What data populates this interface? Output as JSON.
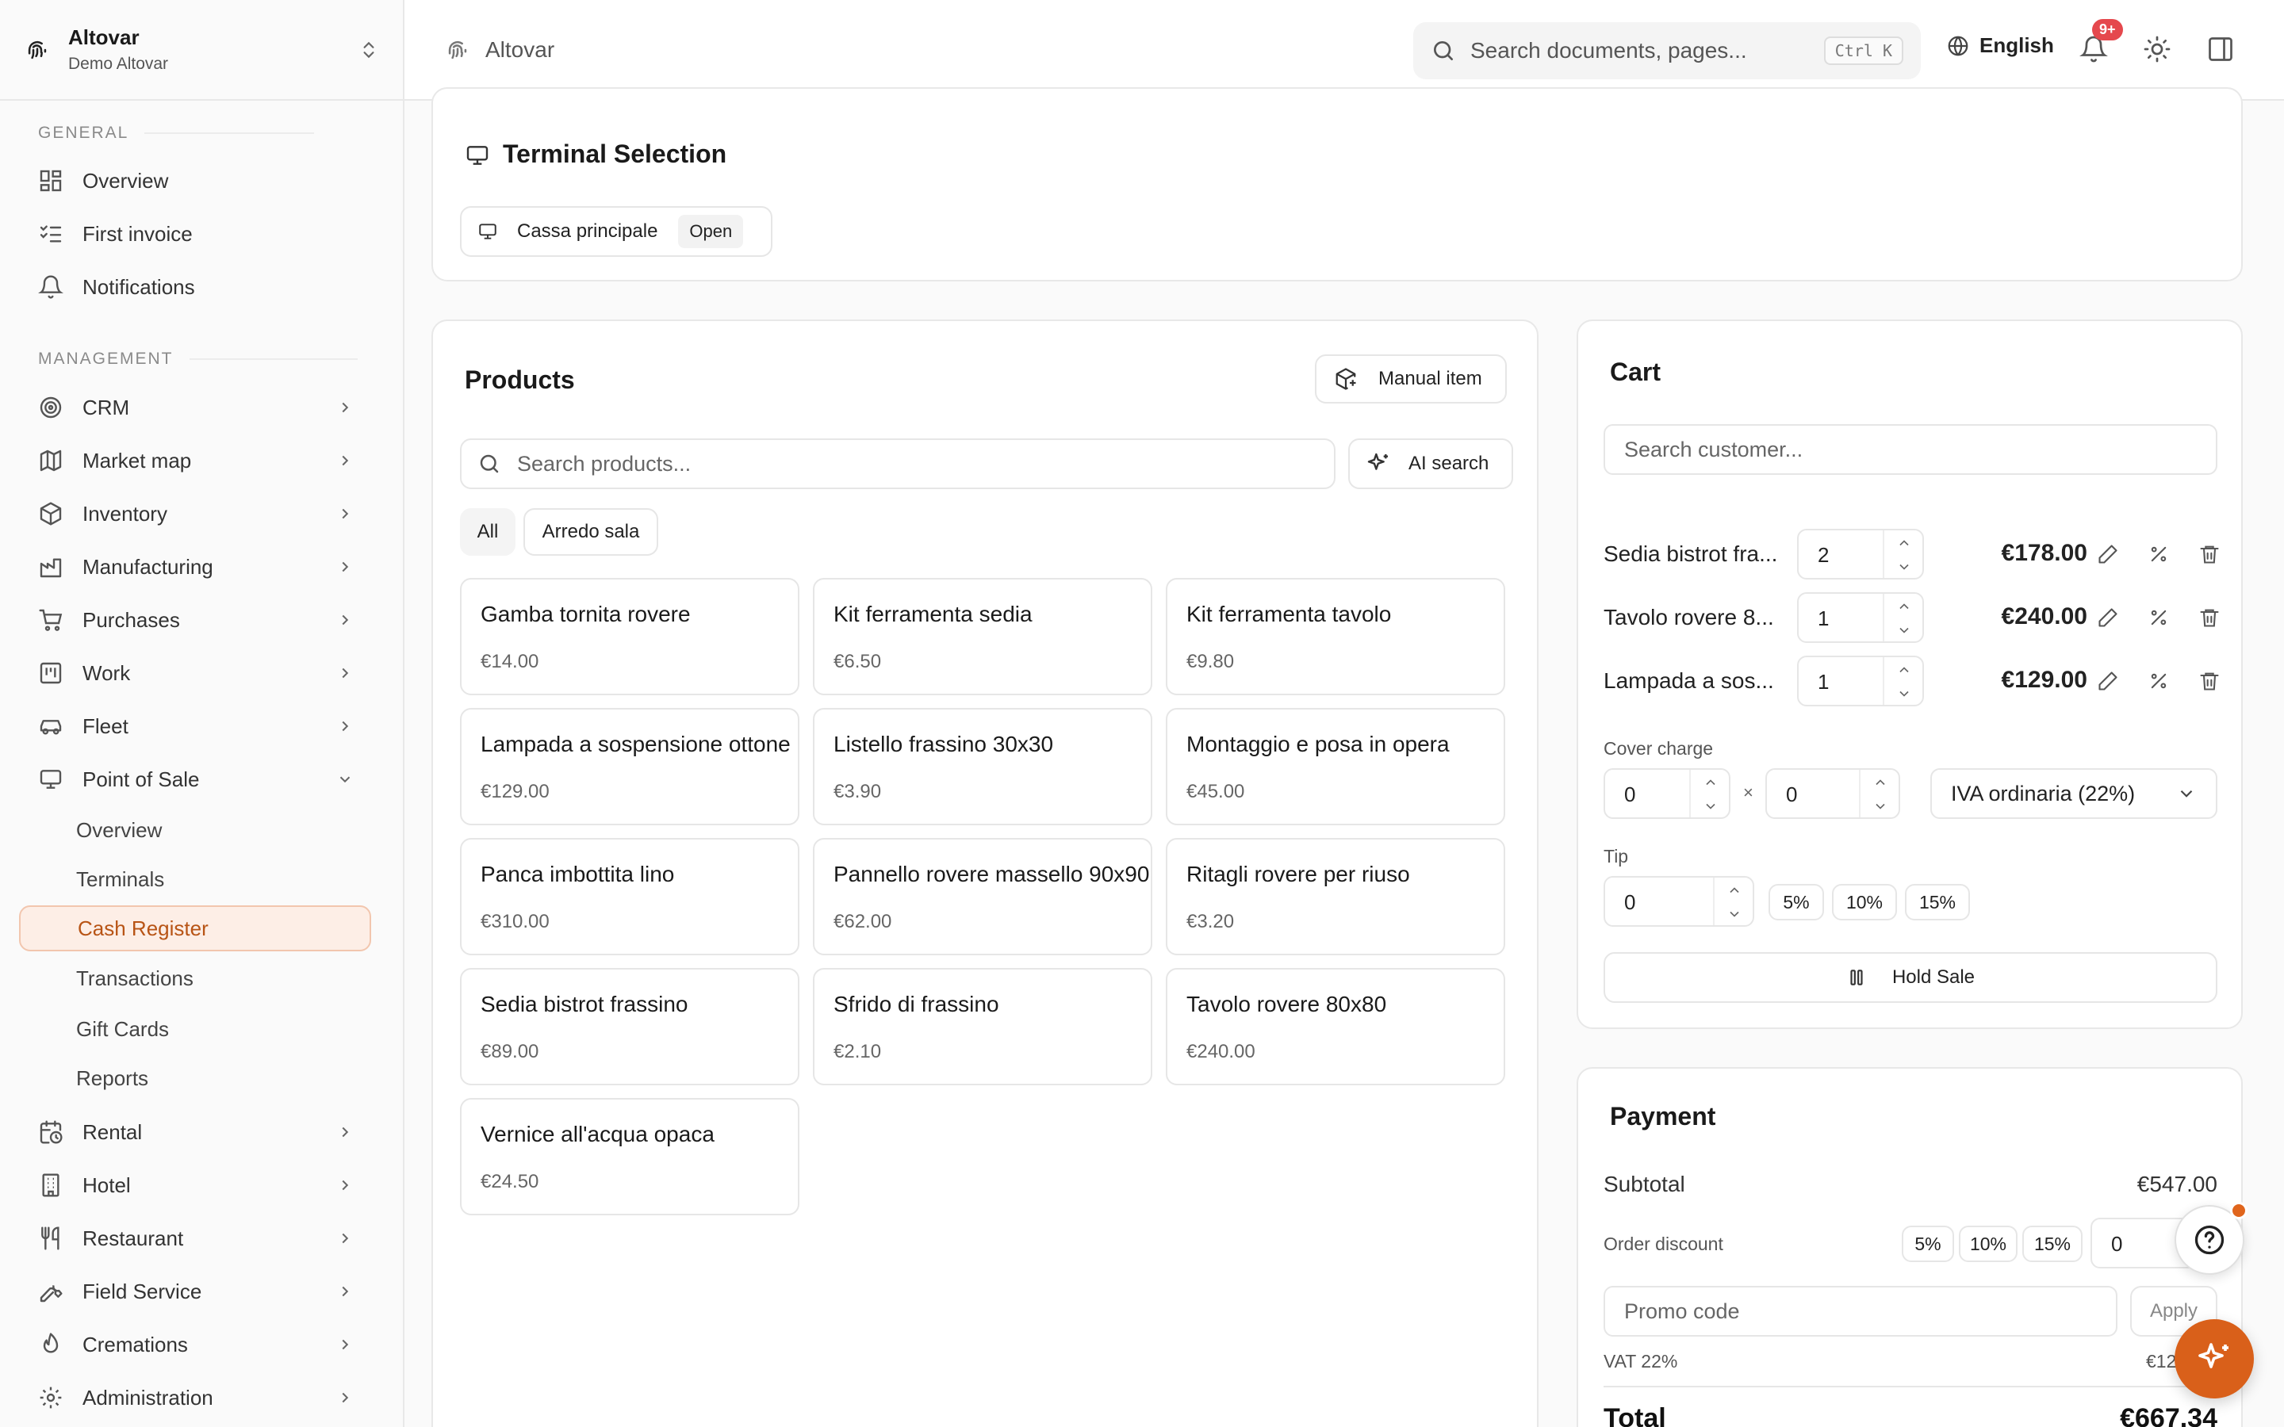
{
  "org": {
    "name": "Altovar",
    "sub": "Demo Altovar"
  },
  "sidebar": {
    "general_label": "GENERAL",
    "general": [
      {
        "label": "Overview"
      },
      {
        "label": "First invoice"
      },
      {
        "label": "Notifications"
      }
    ],
    "management_label": "MANAGEMENT",
    "management": [
      {
        "label": "CRM"
      },
      {
        "label": "Market map"
      },
      {
        "label": "Inventory"
      },
      {
        "label": "Manufacturing"
      },
      {
        "label": "Purchases"
      },
      {
        "label": "Work"
      },
      {
        "label": "Fleet"
      },
      {
        "label": "Point of Sale"
      }
    ],
    "pos_sub": [
      {
        "label": "Overview"
      },
      {
        "label": "Terminals"
      },
      {
        "label": "Cash Register"
      },
      {
        "label": "Transactions"
      },
      {
        "label": "Gift Cards"
      },
      {
        "label": "Reports"
      }
    ],
    "more": [
      {
        "label": "Rental"
      },
      {
        "label": "Hotel"
      },
      {
        "label": "Restaurant"
      },
      {
        "label": "Field Service"
      },
      {
        "label": "Cremations"
      },
      {
        "label": "Administration"
      }
    ]
  },
  "topbar": {
    "breadcrumb": "Altovar",
    "search_placeholder": "Search documents, pages...",
    "shortcut": "Ctrl K",
    "language": "English",
    "notif_badge": "9+"
  },
  "terminal": {
    "title": "Terminal Selection",
    "name": "Cassa principale",
    "status": "Open"
  },
  "products": {
    "title": "Products",
    "manual_item": "Manual item",
    "search_placeholder": "Search products...",
    "ai_search": "AI search",
    "filters": [
      "All",
      "Arredo sala"
    ],
    "items": [
      {
        "name": "Gamba tornita rovere",
        "price": "€14.00"
      },
      {
        "name": "Kit ferramenta sedia",
        "price": "€6.50"
      },
      {
        "name": "Kit ferramenta tavolo",
        "price": "€9.80"
      },
      {
        "name": "Lampada a sospensione ottone",
        "price": "€129.00"
      },
      {
        "name": "Listello frassino 30x30",
        "price": "€3.90"
      },
      {
        "name": "Montaggio e posa in opera",
        "price": "€45.00"
      },
      {
        "name": "Panca imbottita lino",
        "price": "€310.00"
      },
      {
        "name": "Pannello rovere massello 90x90",
        "price": "€62.00"
      },
      {
        "name": "Ritagli rovere per riuso",
        "price": "€3.20"
      },
      {
        "name": "Sedia bistrot frassino",
        "price": "€89.00"
      },
      {
        "name": "Sfrido di frassino",
        "price": "€2.10"
      },
      {
        "name": "Tavolo rovere 80x80",
        "price": "€240.00"
      },
      {
        "name": "Vernice all'acqua opaca",
        "price": "€24.50"
      }
    ]
  },
  "cart": {
    "title": "Cart",
    "customer_placeholder": "Search customer...",
    "lines": [
      {
        "name": "Sedia bistrot fra...",
        "qty": "2",
        "total": "€178.00"
      },
      {
        "name": "Tavolo rovere 8...",
        "qty": "1",
        "total": "€240.00"
      },
      {
        "name": "Lampada a sos...",
        "qty": "1",
        "total": "€129.00"
      }
    ],
    "cover_label": "Cover charge",
    "cover_qty": "0",
    "times": "×",
    "cover_price": "0",
    "vat_select": "IVA ordinaria (22%)",
    "tip_label": "Tip",
    "tip_value": "0",
    "tip_options": [
      "5%",
      "10%",
      "15%"
    ],
    "hold_sale": "Hold Sale"
  },
  "payment": {
    "title": "Payment",
    "subtotal_label": "Subtotal",
    "subtotal": "€547.00",
    "discount_label": "Order discount",
    "discount_options": [
      "5%",
      "10%",
      "15%"
    ],
    "discount_value": "0",
    "promo_placeholder": "Promo code",
    "apply": "Apply",
    "vat_label": "VAT 22%",
    "vat_value": "€12",
    "total_label": "Total",
    "total": "€667.34"
  },
  "colors": {
    "accent": "#d9601a",
    "active_bg": "#fdeee6"
  }
}
